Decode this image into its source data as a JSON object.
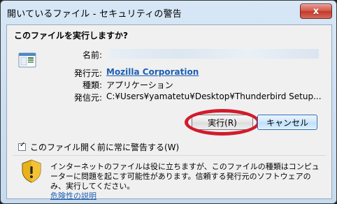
{
  "window": {
    "title": "開いているファイル - セキュリティの警告",
    "close_glyph": "x"
  },
  "dialog": {
    "question": "このファイルを実行しますか?",
    "fields": {
      "name_label": "名前:",
      "name_value": "",
      "publisher_label": "発行元:",
      "publisher_value": "Mozilla Corporation",
      "type_label": "種類:",
      "type_value": "アプリケーション",
      "from_label": "発信元:",
      "from_value": "C:¥Users¥yamatetu¥Desktop¥Thunderbird Setup..."
    },
    "buttons": {
      "run": "実行(R)",
      "cancel": "キャンセル"
    },
    "checkbox": {
      "checked": true,
      "label": "このファイル開く前に常に警告する(W)"
    },
    "note": {
      "text": "インターネットのファイルは役に立ちますが、このファイルの種類はコンピューターに問題を起こす可能性があります。信頼する発行元のソフトウェアのみ、実行してください。",
      "link": "危険性の説明"
    }
  },
  "icons": {
    "app": "application-icon",
    "shield": "warning-shield-icon"
  },
  "colors": {
    "link": "#1d5fb3",
    "highlight": "#d11c2d"
  }
}
